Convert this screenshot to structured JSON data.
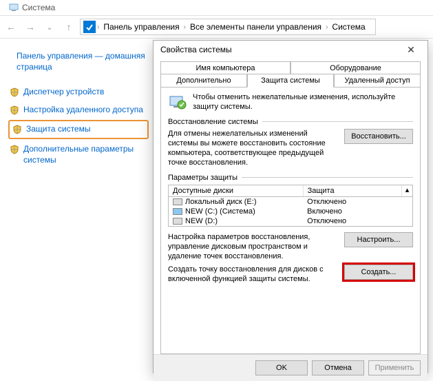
{
  "window": {
    "title": "Система"
  },
  "breadcrumb": {
    "items": [
      "Панель управления",
      "Все элементы панели управления",
      "Система"
    ]
  },
  "sidebar": {
    "home": "Панель управления — домашняя страница",
    "links": [
      "Диспетчер устройств",
      "Настройка удаленного доступа",
      "Защита системы",
      "Дополнительные параметры системы"
    ]
  },
  "dialog": {
    "title": "Свойства системы",
    "tabs_row1": [
      "Имя компьютера",
      "Оборудование"
    ],
    "tabs_row2": [
      "Дополнительно",
      "Защита системы",
      "Удаленный доступ"
    ],
    "intro": "Чтобы отменить нежелательные изменения, используйте защиту системы.",
    "restore_group": "Восстановление системы",
    "restore_text": "Для отмены нежелательных изменений системы вы можете восстановить состояние компьютера, соответствующее предыдущей точке восстановления.",
    "restore_btn": "Восстановить...",
    "params_group": "Параметры защиты",
    "table": {
      "head1": "Доступные диски",
      "head2": "Защита",
      "rows": [
        {
          "name": "Локальный диск (E:)",
          "prot": "Отключено",
          "sys": false
        },
        {
          "name": "NEW (C:) (Система)",
          "prot": "Включено",
          "sys": true
        },
        {
          "name": "NEW (D:)",
          "prot": "Отключено",
          "sys": false
        }
      ]
    },
    "configure_text": "Настройка параметров восстановления, управление дисковым пространством и удаление точек восстановления.",
    "configure_btn": "Настроить...",
    "create_text": "Создать точку восстановления для дисков с включенной функцией защиты системы.",
    "create_btn": "Создать...",
    "footer": {
      "ok": "OK",
      "cancel": "Отмена",
      "apply": "Применить"
    }
  }
}
